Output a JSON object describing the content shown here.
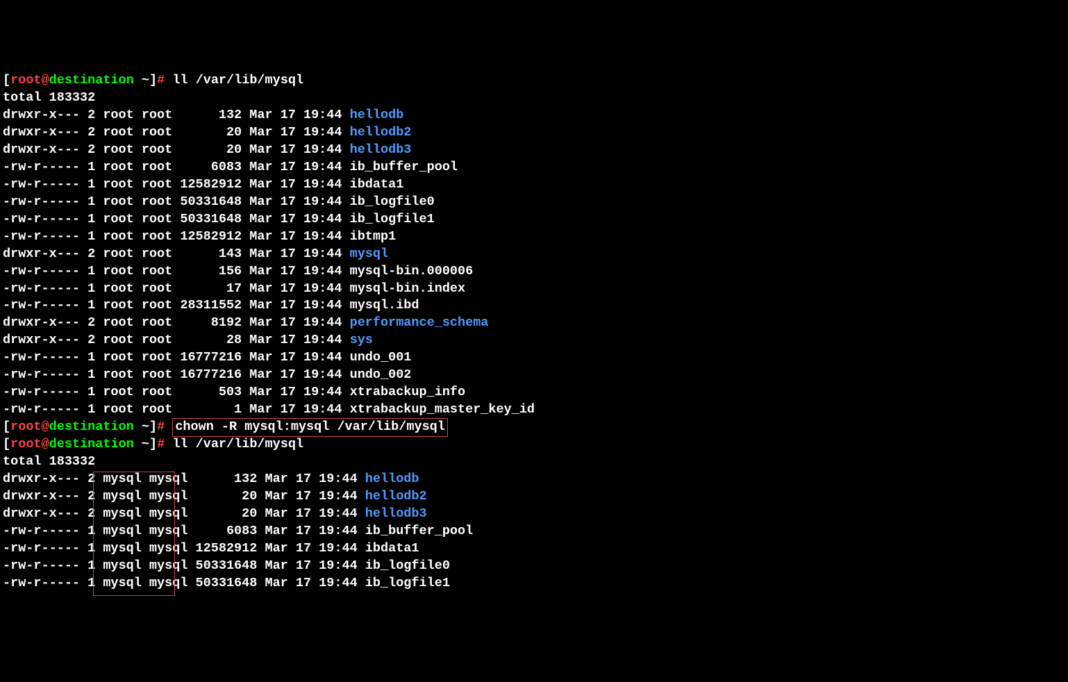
{
  "prompts": [
    {
      "user": "root",
      "at": "@",
      "host": "destination",
      "tilde": " ~",
      "command": "ll /var/lib/mysql"
    },
    {
      "user": "root",
      "at": "@",
      "host": "destination",
      "tilde": " ~",
      "command": "chown -R mysql:mysql /var/lib/mysql",
      "boxed": true
    },
    {
      "user": "root",
      "at": "@",
      "host": "destination",
      "tilde": " ~",
      "command": "ll /var/lib/mysql"
    }
  ],
  "totals": {
    "t1": "total 183332",
    "t2": "total 183332"
  },
  "listing1": [
    {
      "perm": "drwxr-x---",
      "links": "2",
      "user": "root",
      "group": "root",
      "size": "132",
      "date": "Mar 17 19:44",
      "name": "hellodb",
      "dir": true
    },
    {
      "perm": "drwxr-x---",
      "links": "2",
      "user": "root",
      "group": "root",
      "size": "20",
      "date": "Mar 17 19:44",
      "name": "hellodb2",
      "dir": true
    },
    {
      "perm": "drwxr-x---",
      "links": "2",
      "user": "root",
      "group": "root",
      "size": "20",
      "date": "Mar 17 19:44",
      "name": "hellodb3",
      "dir": true
    },
    {
      "perm": "-rw-r-----",
      "links": "1",
      "user": "root",
      "group": "root",
      "size": "6083",
      "date": "Mar 17 19:44",
      "name": "ib_buffer_pool",
      "dir": false
    },
    {
      "perm": "-rw-r-----",
      "links": "1",
      "user": "root",
      "group": "root",
      "size": "12582912",
      "date": "Mar 17 19:44",
      "name": "ibdata1",
      "dir": false
    },
    {
      "perm": "-rw-r-----",
      "links": "1",
      "user": "root",
      "group": "root",
      "size": "50331648",
      "date": "Mar 17 19:44",
      "name": "ib_logfile0",
      "dir": false
    },
    {
      "perm": "-rw-r-----",
      "links": "1",
      "user": "root",
      "group": "root",
      "size": "50331648",
      "date": "Mar 17 19:44",
      "name": "ib_logfile1",
      "dir": false
    },
    {
      "perm": "-rw-r-----",
      "links": "1",
      "user": "root",
      "group": "root",
      "size": "12582912",
      "date": "Mar 17 19:44",
      "name": "ibtmp1",
      "dir": false
    },
    {
      "perm": "drwxr-x---",
      "links": "2",
      "user": "root",
      "group": "root",
      "size": "143",
      "date": "Mar 17 19:44",
      "name": "mysql",
      "dir": true
    },
    {
      "perm": "-rw-r-----",
      "links": "1",
      "user": "root",
      "group": "root",
      "size": "156",
      "date": "Mar 17 19:44",
      "name": "mysql-bin.000006",
      "dir": false
    },
    {
      "perm": "-rw-r-----",
      "links": "1",
      "user": "root",
      "group": "root",
      "size": "17",
      "date": "Mar 17 19:44",
      "name": "mysql-bin.index",
      "dir": false
    },
    {
      "perm": "-rw-r-----",
      "links": "1",
      "user": "root",
      "group": "root",
      "size": "28311552",
      "date": "Mar 17 19:44",
      "name": "mysql.ibd",
      "dir": false
    },
    {
      "perm": "drwxr-x---",
      "links": "2",
      "user": "root",
      "group": "root",
      "size": "8192",
      "date": "Mar 17 19:44",
      "name": "performance_schema",
      "dir": true
    },
    {
      "perm": "drwxr-x---",
      "links": "2",
      "user": "root",
      "group": "root",
      "size": "28",
      "date": "Mar 17 19:44",
      "name": "sys",
      "dir": true
    },
    {
      "perm": "-rw-r-----",
      "links": "1",
      "user": "root",
      "group": "root",
      "size": "16777216",
      "date": "Mar 17 19:44",
      "name": "undo_001",
      "dir": false
    },
    {
      "perm": "-rw-r-----",
      "links": "1",
      "user": "root",
      "group": "root",
      "size": "16777216",
      "date": "Mar 17 19:44",
      "name": "undo_002",
      "dir": false
    },
    {
      "perm": "-rw-r-----",
      "links": "1",
      "user": "root",
      "group": "root",
      "size": "503",
      "date": "Mar 17 19:44",
      "name": "xtrabackup_info",
      "dir": false
    },
    {
      "perm": "-rw-r-----",
      "links": "1",
      "user": "root",
      "group": "root",
      "size": "1",
      "date": "Mar 17 19:44",
      "name": "xtrabackup_master_key_id",
      "dir": false
    }
  ],
  "listing2": [
    {
      "perm": "drwxr-x---",
      "links": "2",
      "user": "mysql",
      "group": "mysql",
      "size": "132",
      "date": "Mar 17 19:44",
      "name": "hellodb",
      "dir": true
    },
    {
      "perm": "drwxr-x---",
      "links": "2",
      "user": "mysql",
      "group": "mysql",
      "size": "20",
      "date": "Mar 17 19:44",
      "name": "hellodb2",
      "dir": true
    },
    {
      "perm": "drwxr-x---",
      "links": "2",
      "user": "mysql",
      "group": "mysql",
      "size": "20",
      "date": "Mar 17 19:44",
      "name": "hellodb3",
      "dir": true
    },
    {
      "perm": "-rw-r-----",
      "links": "1",
      "user": "mysql",
      "group": "mysql",
      "size": "6083",
      "date": "Mar 17 19:44",
      "name": "ib_buffer_pool",
      "dir": false
    },
    {
      "perm": "-rw-r-----",
      "links": "1",
      "user": "mysql",
      "group": "mysql",
      "size": "12582912",
      "date": "Mar 17 19:44",
      "name": "ibdata1",
      "dir": false
    },
    {
      "perm": "-rw-r-----",
      "links": "1",
      "user": "mysql",
      "group": "mysql",
      "size": "50331648",
      "date": "Mar 17 19:44",
      "name": "ib_logfile0",
      "dir": false
    },
    {
      "perm": "-rw-r-----",
      "links": "1",
      "user": "mysql",
      "group": "mysql",
      "size": "50331648",
      "date": "Mar 17 19:44",
      "name": "ib_logfile1",
      "dir": false
    }
  ]
}
